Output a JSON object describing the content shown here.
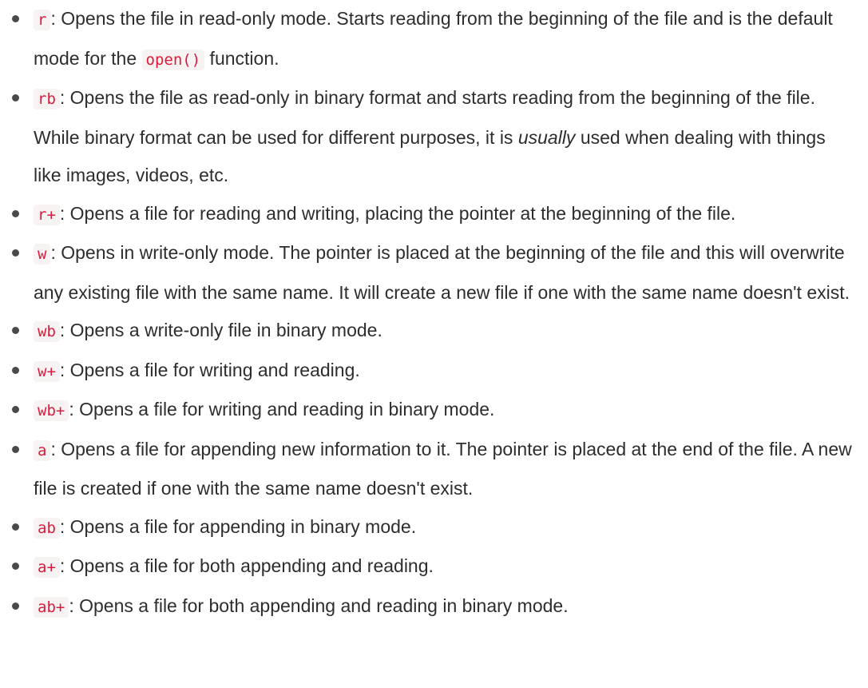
{
  "items": [
    {
      "code": "r",
      "text": ": Opens the file in read-only mode. Starts reading from the beginning of the file and is the default mode for the ",
      "code2": "open()",
      "text2": " function."
    },
    {
      "code": "rb",
      "text": ": Opens the file as read-only in binary format and starts reading from the beginning of the file. While binary format can be used for different purposes, it is ",
      "em": "usually",
      "text2": " used when dealing with things like images, videos, etc."
    },
    {
      "code": "r+",
      "text": ": Opens a file for reading and writing, placing the pointer at the beginning of the file."
    },
    {
      "code": "w",
      "text": ": Opens in write-only mode. The pointer is placed at the beginning of the file and this will overwrite any existing file with the same name. It will create a new file if one with the same name doesn't exist."
    },
    {
      "code": "wb",
      "text": ": Opens a write-only file in binary mode."
    },
    {
      "code": "w+",
      "text": ": Opens a file for writing and reading."
    },
    {
      "code": "wb+",
      "text": ": Opens a file for writing and reading in binary mode."
    },
    {
      "code": "a",
      "text": ": Opens a file for appending new information to it. The pointer is placed at the end of the file. A new file is created if one with the same name doesn't exist."
    },
    {
      "code": "ab",
      "text": ": Opens a file for appending in binary mode."
    },
    {
      "code": "a+",
      "text": ": Opens a file for both appending and reading."
    },
    {
      "code": "ab+",
      "text": ": Opens a file for both appending and reading in binary mode."
    }
  ]
}
